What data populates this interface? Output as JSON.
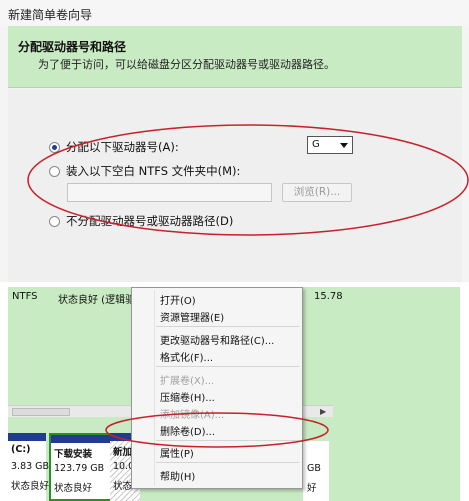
{
  "wizard": {
    "title": "新建简单卷向导",
    "header_title": "分配驱动器号和路径",
    "header_desc": "为了便于访问，可以给磁盘分区分配驱动器号或驱动器路径。",
    "option_assign": "分配以下驱动器号(A):",
    "drive_letter": "G",
    "option_mount": "装入以下空白 NTFS 文件夹中(M):",
    "folder_path": "",
    "browse_label": "浏览(R)...",
    "option_none": "不分配驱动器号或驱动器路径(D)"
  },
  "disk_mgmt": {
    "volume_row": {
      "fs": "NTFS",
      "status": "状态良好 (逻辑驱动",
      "size_tail": "15.78"
    },
    "partitions": [
      {
        "name": "(C:)",
        "size": "3.83 GB",
        "status": "状态良好"
      },
      {
        "name": "下载安装",
        "size": "123.79 GB",
        "status": "状态良好"
      },
      {
        "name": "新加",
        "size": "10.0",
        "status": "状态"
      }
    ],
    "right_partition": {
      "size": "GB",
      "status": "好"
    }
  },
  "context_menu": {
    "items": [
      {
        "label": "打开(O)",
        "enabled": true
      },
      {
        "label": "资源管理器(E)",
        "enabled": true
      },
      {
        "label": "更改驱动器号和路径(C)...",
        "enabled": true
      },
      {
        "label": "格式化(F)...",
        "enabled": true
      },
      {
        "label": "扩展卷(X)...",
        "enabled": false
      },
      {
        "label": "压缩卷(H)...",
        "enabled": true
      },
      {
        "label": "添加镜像(A)...",
        "enabled": false
      },
      {
        "label": "删除卷(D)...",
        "enabled": true
      },
      {
        "label": "属性(P)",
        "enabled": true
      },
      {
        "label": "帮助(H)",
        "enabled": true
      }
    ]
  },
  "colors": {
    "header_green": "#c9ebc3",
    "partition_bar": "#1f3d8c",
    "highlight_oval": "#c8202a"
  }
}
